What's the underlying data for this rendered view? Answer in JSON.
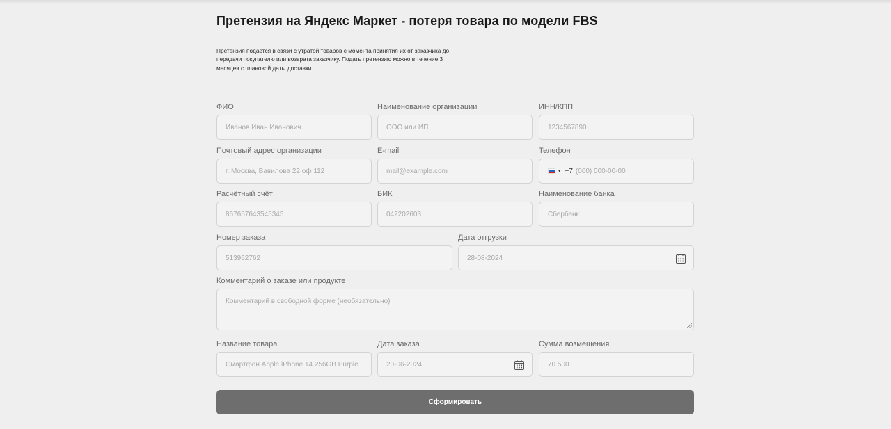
{
  "page": {
    "title": "Претензия на Яндекс Маркет - потеря товара по модели FBS",
    "description": "Претензия подается в связи с утратой товаров с момента принятия их от заказчика до передачи покупателю или возврата заказчику. Подать претензию можно в течение 3 месяцев с плановой даты доставки."
  },
  "form": {
    "fio": {
      "label": "ФИО",
      "placeholder": "Иванов Иван Иванович"
    },
    "org_name": {
      "label": "Наименование организации",
      "placeholder": "ООО или ИП"
    },
    "inn_kpp": {
      "label": "ИНН/КПП",
      "placeholder": "1234567890"
    },
    "postal_address": {
      "label": "Почтовый адрес организации",
      "placeholder": "г. Москва, Вавилова 22 оф 112"
    },
    "email": {
      "label": "E-mail",
      "placeholder": "mail@example.com"
    },
    "phone": {
      "label": "Телефон",
      "code": "+7",
      "placeholder": "(000) 000-00-00",
      "country_flag": "flag-ru-icon"
    },
    "account": {
      "label": "Расчётный счёт",
      "placeholder": "867657643545345"
    },
    "bik": {
      "label": "БИК",
      "placeholder": "042202603"
    },
    "bank_name": {
      "label": "Наименование банка",
      "placeholder": "Сбербанк"
    },
    "order_number": {
      "label": "Номер заказа",
      "placeholder": "513962762"
    },
    "shipment_date": {
      "label": "Дата отгрузки",
      "placeholder": "28-08-2024",
      "icon": "calendar-icon"
    },
    "comment": {
      "label": "Комментарий о заказе или продукте",
      "placeholder": "Комментарий в свободной форме (необязательно)"
    },
    "product_name": {
      "label": "Название товара",
      "placeholder": "Смартфон Apple iPhone 14 256GB Purple"
    },
    "order_date": {
      "label": "Дата заказа",
      "placeholder": "20-06-2024",
      "icon": "calendar-icon"
    },
    "refund_amount": {
      "label": "Сумма возмещения",
      "placeholder": "70 500"
    },
    "submit_label": "Сформировать"
  },
  "colors": {
    "background": "#efefef",
    "input_background": "#f3f3f3",
    "input_border": "#d3d3d3",
    "button": "#6e6e6e",
    "button_text": "#ffffff"
  }
}
